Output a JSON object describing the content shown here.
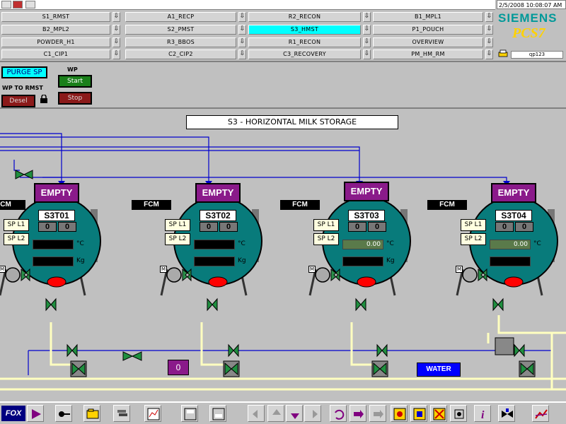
{
  "header": {
    "datetime": "2/5/2008 10:08:07 AM",
    "brand": "SIEMENS",
    "product": "PCS7",
    "station_field": "qp123",
    "nav_buttons": [
      [
        "S1_RMST",
        "A1_RECP",
        "R2_RECON",
        "B1_MPL1"
      ],
      [
        "B2_MPL2",
        "S2_PMST",
        "S3_HMST",
        "P1_POUCH"
      ],
      [
        "POWDER_H1",
        "R3_BBOS",
        "R1_RECON",
        "OVERVIEW"
      ],
      [
        "C1_CIP1",
        "C2_CIP2",
        "C3_RECOVERY",
        "PM_HM_RM"
      ]
    ],
    "active_button": "S3_HMST"
  },
  "controls": {
    "purge_label": "PURGE SP",
    "wp_label": "WP",
    "start_label": "Start",
    "stop_label": "Stop",
    "wp_to_rmst_label": "WP TO RMST",
    "desel_label": "Desel"
  },
  "process": {
    "title": "S3 - HORIZONTAL MILK STORAGE",
    "tanks": [
      {
        "id": "S3T01",
        "status": "EMPTY",
        "fcm": "CM",
        "sp1": "SP L1",
        "sp2": "SP L2",
        "val1": "0",
        "val2": "0",
        "temp": "",
        "weight": "",
        "temp_unit": "°C",
        "weight_unit": "Kg"
      },
      {
        "id": "S3T02",
        "status": "EMPTY",
        "fcm": "FCM",
        "sp1": "SP L1",
        "sp2": "SP L2",
        "val1": "0",
        "val2": "0",
        "temp": "",
        "weight": "",
        "temp_unit": "°C",
        "weight_unit": "Kg"
      },
      {
        "id": "S3T03",
        "status": "EMPTY",
        "fcm": "FCM",
        "sp1": "SP L1",
        "sp2": "SP L2",
        "val1": "0",
        "val2": "0",
        "temp": "0.00",
        "weight": "",
        "temp_unit": "°C",
        "weight_unit": "Kg"
      },
      {
        "id": "S3T04",
        "status": "EMPTY",
        "fcm": "FCM",
        "sp1": "SP L1",
        "sp2": "SP L2",
        "val1": "0",
        "val2": "0",
        "temp": "0.00",
        "weight": "",
        "temp_unit": "°C",
        "weight_unit": ""
      }
    ],
    "counter": "0",
    "water_label": "WATER",
    "motor_label": "M"
  },
  "toolbar": {
    "fox_label": "FOX"
  },
  "colors": {
    "tank": "#087b7b",
    "status_purple": "#8a1a8a",
    "pipe_blue": "#0000cc",
    "pipe_yellow": "#ffffc0",
    "valve_green": "#1f8f3f"
  }
}
